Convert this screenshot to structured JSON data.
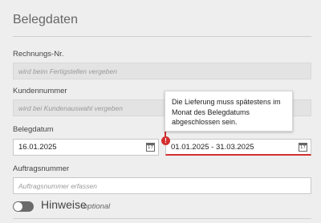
{
  "section": {
    "title": "Belegdaten"
  },
  "fields": {
    "rechnungsnr": {
      "label": "Rechnungs-Nr.",
      "placeholder": "wird beim Fertigstellen vergeben"
    },
    "kundennummer": {
      "label": "Kundennummer",
      "placeholder": "wird bei Kundenauswahl vergeben"
    },
    "belegdatum": {
      "label": "Belegdatum",
      "value": "16.01.2025",
      "icon": "calendar-icon"
    },
    "lieferzeitraum": {
      "value": "01.01.2025 - 31.03.2025",
      "icon": "calendar-icon"
    },
    "auftragsnummer": {
      "label": "Auftragsnummer",
      "placeholder": "Auftragsnummer erfassen"
    }
  },
  "tooltip": {
    "text": "Die Lieferung muss spätestens im Monat des Belegdatums abgeschlossen sein."
  },
  "error_icon": {
    "symbol": "!"
  },
  "hinweise": {
    "label": "Hinweise",
    "optional": "optional"
  },
  "colors": {
    "error": "#d32f2f",
    "background": "#eeeeee"
  }
}
